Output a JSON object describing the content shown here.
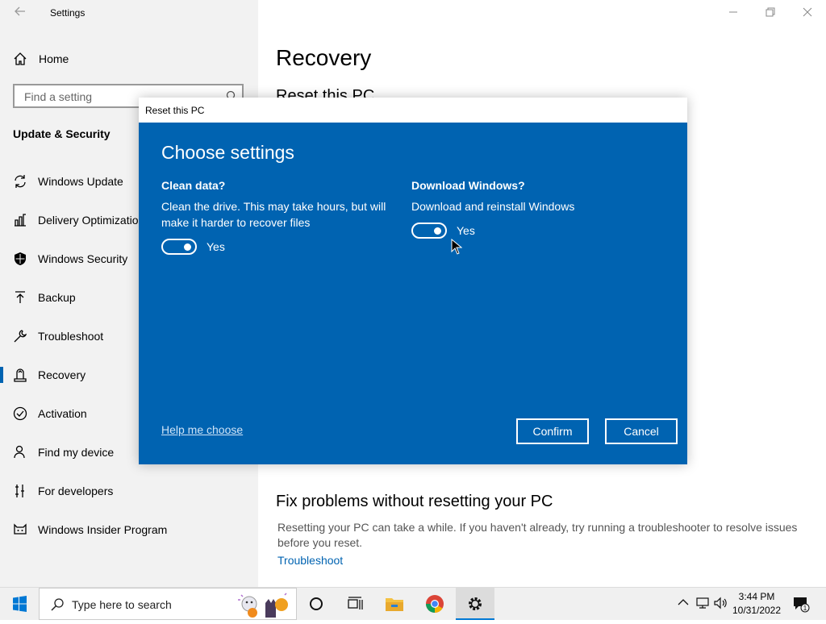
{
  "window": {
    "title": "Settings",
    "back_icon": "back-arrow-icon",
    "controls": [
      "minimize-icon",
      "restore-icon",
      "close-icon"
    ]
  },
  "sidebar": {
    "home_label": "Home",
    "search_placeholder": "Find a setting",
    "section_title": "Update & Security",
    "items": [
      {
        "label": "Windows Update",
        "icon": "sync-icon"
      },
      {
        "label": "Delivery Optimization",
        "icon": "delivery-optimization-icon"
      },
      {
        "label": "Windows Security",
        "icon": "shield-icon"
      },
      {
        "label": "Backup",
        "icon": "backup-arrow-icon"
      },
      {
        "label": "Troubleshoot",
        "icon": "wrench-icon"
      },
      {
        "label": "Recovery",
        "icon": "recovery-icon",
        "active": true
      },
      {
        "label": "Activation",
        "icon": "check-circle-icon"
      },
      {
        "label": "Find my device",
        "icon": "person-pin-icon"
      },
      {
        "label": "For developers",
        "icon": "developer-tools-icon"
      },
      {
        "label": "Windows Insider Program",
        "icon": "insider-cat-icon"
      }
    ]
  },
  "main": {
    "title": "Recovery",
    "reset_heading": "Reset this PC",
    "fix_heading": "Fix problems without resetting your PC",
    "fix_desc": "Resetting your PC can take a while. If you haven't already, try running a troubleshooter to resolve issues before you reset.",
    "troubleshoot_link": "Troubleshoot"
  },
  "dialog": {
    "title": "Reset this PC",
    "heading": "Choose settings",
    "clean_data": {
      "heading": "Clean data?",
      "desc": "Clean the drive. This may take hours, but will make it harder to recover files",
      "state": "Yes",
      "on": true
    },
    "download_windows": {
      "heading": "Download Windows?",
      "desc": "Download and reinstall Windows",
      "state": "Yes",
      "on": true
    },
    "help_link": "Help me choose",
    "confirm": "Confirm",
    "cancel": "Cancel"
  },
  "taskbar": {
    "search_placeholder": "Type here to search",
    "apps": [
      "cortana-icon",
      "task-view-icon",
      "file-explorer-icon",
      "chrome-icon",
      "settings-gear-icon"
    ],
    "time": "3:44 PM",
    "date": "10/31/2022",
    "notification_count": "1"
  },
  "colors": {
    "accent": "#0063b1",
    "sidebar_bg": "#f2f2f2",
    "taskbar_bg": "#f0f0f0"
  }
}
